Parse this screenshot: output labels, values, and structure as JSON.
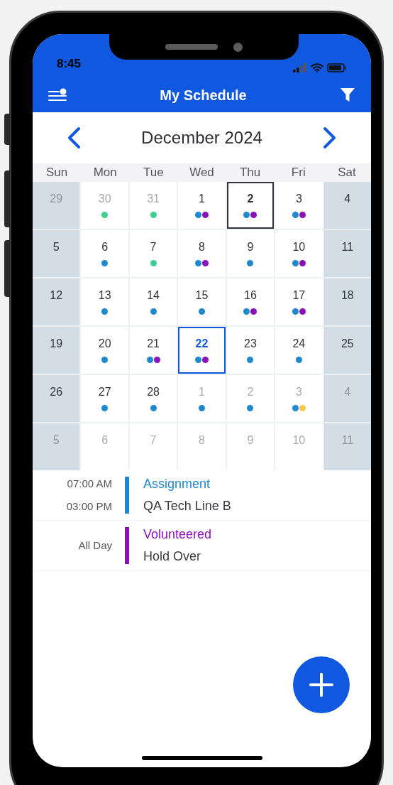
{
  "status_bar": {
    "time": "8:45"
  },
  "header": {
    "title": "My Schedule"
  },
  "calendar": {
    "month": "December 2024",
    "weekdays": [
      "Sun",
      "Mon",
      "Tue",
      "Wed",
      "Thu",
      "Fri",
      "Sat"
    ],
    "days": [
      {
        "day": "29",
        "muted": true,
        "shaded": true,
        "today": false,
        "selected": false
      },
      {
        "day": "30",
        "muted": true,
        "shaded": false,
        "today": false,
        "selected": false,
        "dots": [
          {
            "color": "#3ccf8e"
          }
        ]
      },
      {
        "day": "31",
        "muted": true,
        "shaded": false,
        "today": false,
        "selected": false,
        "dots": [
          {
            "color": "#3ccf8e"
          }
        ]
      },
      {
        "day": "1",
        "muted": false,
        "shaded": false,
        "today": false,
        "selected": false,
        "dots": [
          {
            "color": "#1e88d0"
          },
          {
            "color": "#8a12b8"
          }
        ]
      },
      {
        "day": "2",
        "muted": false,
        "shaded": false,
        "today": true,
        "selected": false,
        "dots": [
          {
            "color": "#1e88d0"
          },
          {
            "color": "#8a12b8"
          }
        ]
      },
      {
        "day": "3",
        "muted": false,
        "shaded": false,
        "today": false,
        "selected": false,
        "dots": [
          {
            "color": "#1e88d0"
          },
          {
            "color": "#8a12b8"
          }
        ]
      },
      {
        "day": "4",
        "muted": false,
        "shaded": true,
        "today": false,
        "selected": false
      },
      {
        "day": "5",
        "muted": false,
        "shaded": true,
        "today": false,
        "selected": false
      },
      {
        "day": "6",
        "muted": false,
        "shaded": false,
        "today": false,
        "selected": false,
        "dots": [
          {
            "color": "#1e88d0"
          }
        ]
      },
      {
        "day": "7",
        "muted": false,
        "shaded": false,
        "today": false,
        "selected": false,
        "dots": [
          {
            "color": "#3ccf8e"
          }
        ]
      },
      {
        "day": "8",
        "muted": false,
        "shaded": false,
        "today": false,
        "selected": false,
        "dots": [
          {
            "color": "#1e88d0"
          },
          {
            "color": "#8a12b8"
          }
        ]
      },
      {
        "day": "9",
        "muted": false,
        "shaded": false,
        "today": false,
        "selected": false,
        "dots": [
          {
            "color": "#1e88d0"
          }
        ]
      },
      {
        "day": "10",
        "muted": false,
        "shaded": false,
        "today": false,
        "selected": false,
        "dots": [
          {
            "color": "#1e88d0"
          },
          {
            "color": "#8a12b8"
          }
        ]
      },
      {
        "day": "11",
        "muted": false,
        "shaded": true,
        "today": false,
        "selected": false
      },
      {
        "day": "12",
        "muted": false,
        "shaded": true,
        "today": false,
        "selected": false
      },
      {
        "day": "13",
        "muted": false,
        "shaded": false,
        "today": false,
        "selected": false,
        "dots": [
          {
            "color": "#1e88d0"
          }
        ]
      },
      {
        "day": "14",
        "muted": false,
        "shaded": false,
        "today": false,
        "selected": false,
        "dots": [
          {
            "color": "#1e88d0"
          }
        ]
      },
      {
        "day": "15",
        "muted": false,
        "shaded": false,
        "today": false,
        "selected": false,
        "dots": [
          {
            "color": "#1e88d0"
          }
        ]
      },
      {
        "day": "16",
        "muted": false,
        "shaded": false,
        "today": false,
        "selected": false,
        "dots": [
          {
            "color": "#1e88d0"
          },
          {
            "color": "#8a12b8"
          }
        ]
      },
      {
        "day": "17",
        "muted": false,
        "shaded": false,
        "today": false,
        "selected": false,
        "dots": [
          {
            "color": "#1e88d0"
          },
          {
            "color": "#8a12b8"
          }
        ]
      },
      {
        "day": "18",
        "muted": false,
        "shaded": true,
        "today": false,
        "selected": false
      },
      {
        "day": "19",
        "muted": false,
        "shaded": true,
        "today": false,
        "selected": false
      },
      {
        "day": "20",
        "muted": false,
        "shaded": false,
        "today": false,
        "selected": false,
        "dots": [
          {
            "color": "#1e88d0"
          }
        ]
      },
      {
        "day": "21",
        "muted": false,
        "shaded": false,
        "today": false,
        "selected": false,
        "dots": [
          {
            "color": "#1e88d0"
          },
          {
            "color": "#8a12b8"
          }
        ]
      },
      {
        "day": "22",
        "muted": false,
        "shaded": false,
        "today": false,
        "selected": true,
        "dots": [
          {
            "color": "#1e88d0"
          },
          {
            "color": "#8a12b8"
          }
        ]
      },
      {
        "day": "23",
        "muted": false,
        "shaded": false,
        "today": false,
        "selected": false,
        "dots": [
          {
            "color": "#1e88d0"
          }
        ]
      },
      {
        "day": "24",
        "muted": false,
        "shaded": false,
        "today": false,
        "selected": false,
        "dots": [
          {
            "color": "#1e88d0"
          }
        ]
      },
      {
        "day": "25",
        "muted": false,
        "shaded": true,
        "today": false,
        "selected": false
      },
      {
        "day": "26",
        "muted": false,
        "shaded": true,
        "today": false,
        "selected": false
      },
      {
        "day": "27",
        "muted": false,
        "shaded": false,
        "today": false,
        "selected": false,
        "dots": [
          {
            "color": "#1e88d0"
          }
        ]
      },
      {
        "day": "28",
        "muted": false,
        "shaded": false,
        "today": false,
        "selected": false,
        "dots": [
          {
            "color": "#1e88d0"
          }
        ]
      },
      {
        "day": "1",
        "muted": true,
        "shaded": false,
        "today": false,
        "selected": false,
        "dots": [
          {
            "color": "#1e88d0"
          }
        ]
      },
      {
        "day": "2",
        "muted": true,
        "shaded": false,
        "today": false,
        "selected": false,
        "dots": [
          {
            "color": "#1e88d0"
          }
        ]
      },
      {
        "day": "3",
        "muted": true,
        "shaded": false,
        "today": false,
        "selected": false,
        "dots": [
          {
            "color": "#1e88d0"
          },
          {
            "color": "#fbc94a"
          }
        ]
      },
      {
        "day": "4",
        "muted": true,
        "shaded": true,
        "today": false,
        "selected": false
      },
      {
        "day": "5",
        "muted": true,
        "shaded": true,
        "today": false,
        "selected": false
      },
      {
        "day": "6",
        "muted": true,
        "shaded": false,
        "today": false,
        "selected": false
      },
      {
        "day": "7",
        "muted": true,
        "shaded": false,
        "today": false,
        "selected": false
      },
      {
        "day": "8",
        "muted": true,
        "shaded": false,
        "today": false,
        "selected": false
      },
      {
        "day": "9",
        "muted": true,
        "shaded": false,
        "today": false,
        "selected": false
      },
      {
        "day": "10",
        "muted": true,
        "shaded": false,
        "today": false,
        "selected": false
      },
      {
        "day": "11",
        "muted": true,
        "shaded": true,
        "today": false,
        "selected": false
      }
    ]
  },
  "events": [
    {
      "times": [
        "07:00 AM",
        "03:00 PM"
      ],
      "type": "Assignment",
      "name": "QA Tech Line B",
      "color": "#1e88d0"
    },
    {
      "times": [
        "All Day"
      ],
      "type": "Volunteered",
      "name": "Hold Over",
      "color": "#8a12b8"
    }
  ]
}
